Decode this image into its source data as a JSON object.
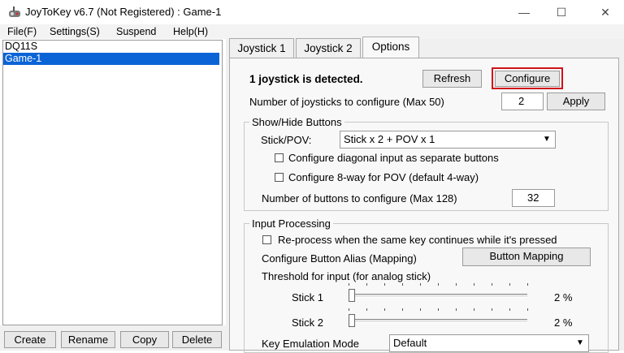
{
  "window": {
    "title": "JoyToKey v6.7 (Not Registered) : Game-1",
    "minimize": "—",
    "maximize": "☐",
    "close": "✕"
  },
  "menu": [
    "File(F)",
    "Settings(S)",
    "Suspend",
    "Help(H)"
  ],
  "profiles": [
    "DQ11S",
    "Game-1"
  ],
  "selected_profile": "Game-1",
  "profile_buttons": {
    "create": "Create",
    "rename": "Rename",
    "copy": "Copy",
    "delete": "Delete"
  },
  "tabs": [
    "Joystick 1",
    "Joystick 2",
    "Options"
  ],
  "active_tab": "Options",
  "options": {
    "detected_text": "1 joystick is detected.",
    "refresh": "Refresh",
    "configure": "Configure",
    "num_joysticks_label": "Number of joysticks to configure (Max 50)",
    "num_joysticks_value": "2",
    "apply": "Apply",
    "show_hide": {
      "title": "Show/Hide Buttons",
      "stick_pov_label": "Stick/POV:",
      "stick_pov_value": "Stick x 2 + POV x 1",
      "diagonal_label": "Configure diagonal input as separate buttons",
      "diagonal_checked": false,
      "eightway_label": "Configure 8-way for POV (default 4-way)",
      "eightway_checked": false,
      "num_buttons_label": "Number of buttons to configure (Max 128)",
      "num_buttons_value": "32"
    },
    "input_processing": {
      "title": "Input Processing",
      "reprocess_label": "Re-process when the same key continues while it's pressed",
      "reprocess_checked": false,
      "alias_label": "Configure Button Alias (Mapping)",
      "button_mapping": "Button Mapping",
      "threshold_label": "Threshold for input (for analog stick)",
      "stick1_label": "Stick 1",
      "stick1_value": "2 %",
      "stick1_fraction": 0.02,
      "stick2_label": "Stick 2",
      "stick2_value": "2 %",
      "stick2_fraction": 0.02,
      "key_emulation_label": "Key Emulation Mode",
      "key_emulation_value": "Default"
    }
  },
  "colors": {
    "selection": "#0b64d6",
    "configure_highlight": "#d0121b"
  }
}
